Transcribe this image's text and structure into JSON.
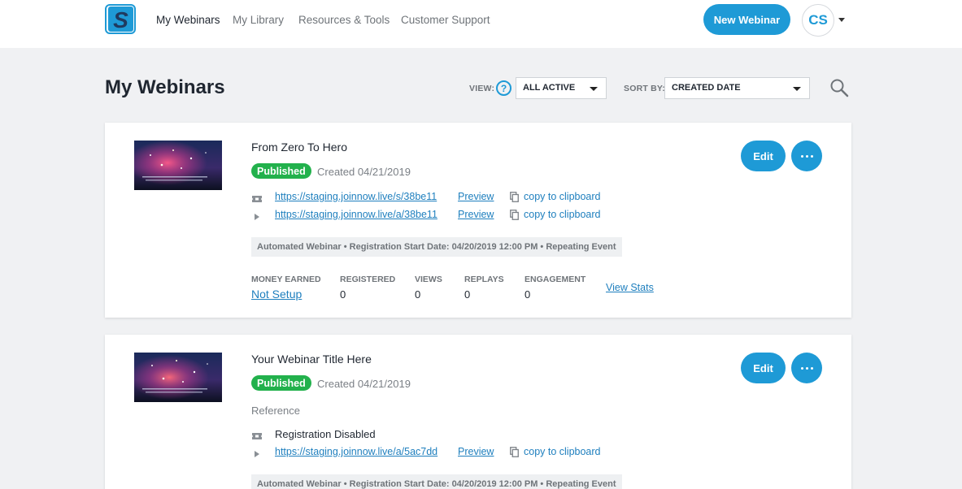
{
  "nav": {
    "items": [
      {
        "label": "My Webinars",
        "active": true
      },
      {
        "label": "My Library",
        "active": false
      },
      {
        "label": "Resources & Tools",
        "active": false
      },
      {
        "label": "Customer Support",
        "active": false
      }
    ],
    "new_webinar_label": "New Webinar",
    "avatar_initials": "CS"
  },
  "header": {
    "title": "My Webinars",
    "view_label": "VIEW:",
    "view_value": "ALL ACTIVE",
    "sort_label": "SORT BY:",
    "sort_value": "CREATED DATE"
  },
  "webinars": [
    {
      "title": "From Zero To Hero",
      "status": "Published",
      "created": "Created 04/21/2019",
      "registration_url": "https://staging.joinnow.live/s/38be11",
      "replay_url": "https://staging.joinnow.live/a/38be11",
      "preview_label": "Preview",
      "copy_label": "copy to clipboard",
      "info": "Automated Webinar • Registration Start Date: 04/20/2019 12:00 PM • Repeating Event",
      "stats": {
        "money_label": "MONEY EARNED",
        "money_value": "Not Setup",
        "registered_label": "REGISTERED",
        "registered_value": "0",
        "views_label": "VIEWS",
        "views_value": "0",
        "replays_label": "REPLAYS",
        "replays_value": "0",
        "engagement_label": "ENGAGEMENT",
        "engagement_value": "0",
        "view_stats_label": "View Stats"
      },
      "edit_label": "Edit"
    },
    {
      "title": "Your Webinar Title Here",
      "status": "Published",
      "created": "Created 04/21/2019",
      "reference": "Reference",
      "registration_text": "Registration Disabled",
      "replay_url": "https://staging.joinnow.live/a/5ac7dd",
      "preview_label": "Preview",
      "copy_label": "copy to clipboard",
      "info": "Automated Webinar • Registration Start Date: 04/20/2019 12:00 PM • Repeating Event",
      "edit_label": "Edit"
    }
  ],
  "colors": {
    "accent": "#1e9ad6",
    "published": "#22b14c",
    "link": "#1e7fbe",
    "background": "#f0f1f3"
  }
}
